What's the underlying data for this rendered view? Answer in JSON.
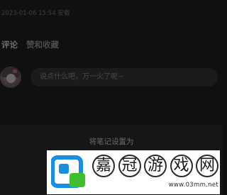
{
  "note": {
    "meta": "2023-01-06 15:54 安徽"
  },
  "tabs": {
    "comments_label": "评论",
    "likes_label": "赞和收藏"
  },
  "comment_box": {
    "placeholder": "说点什么吧，万一火了呢~"
  },
  "bottom_sheet": {
    "title": "将笔记设置为"
  },
  "watermark": {
    "chars": [
      "嘉",
      "冠",
      "游",
      "戏",
      "网"
    ],
    "url": "www.03mm.net"
  },
  "colors": {
    "background": "#101010",
    "sheet": "#161616",
    "logo_blue": "#1a8fe0",
    "logo_green": "#3fbf2f"
  }
}
